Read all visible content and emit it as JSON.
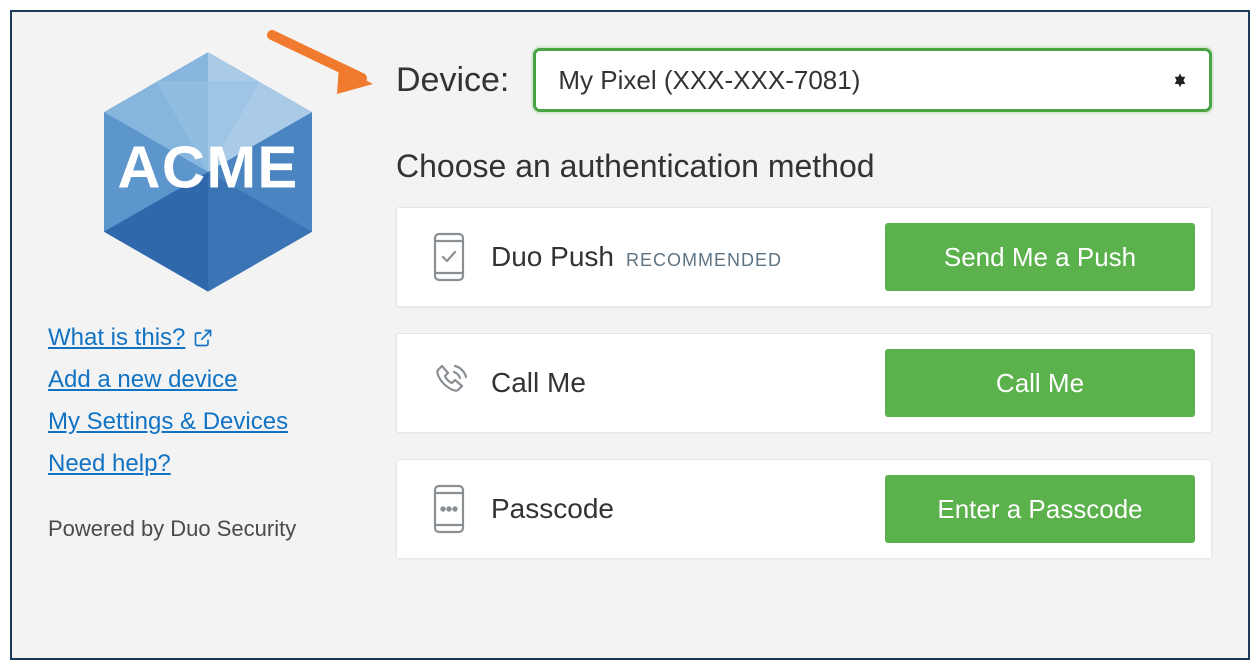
{
  "logo_text": "ACME",
  "links": {
    "what": "What is this?",
    "add": "Add a new device",
    "settings": "My Settings & Devices",
    "help": "Need help?"
  },
  "powered": "Powered by Duo Security",
  "device": {
    "label": "Device:",
    "selected": "My Pixel (XXX-XXX-7081)"
  },
  "choose_heading": "Choose an authentication method",
  "methods": {
    "push": {
      "label": "Duo Push",
      "badge": "RECOMMENDED",
      "button": "Send Me a Push"
    },
    "call": {
      "label": "Call Me",
      "button": "Call Me"
    },
    "passcode": {
      "label": "Passcode",
      "button": "Enter a Passcode"
    }
  }
}
